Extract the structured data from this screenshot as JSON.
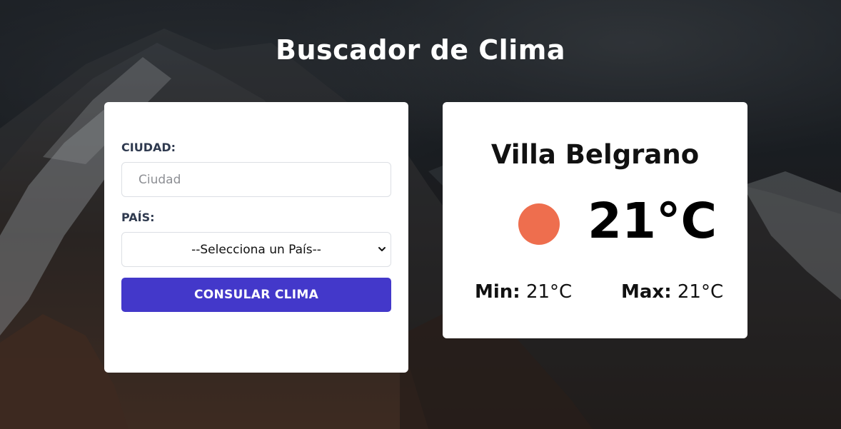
{
  "header": {
    "title": "Buscador de Clima"
  },
  "form": {
    "city_label": "CIUDAD:",
    "city_placeholder": "Ciudad",
    "city_value": "",
    "country_label": "PAÍS:",
    "country_selected": "--Selecciona un País--",
    "submit_label": "CONSULAR CLIMA",
    "submit_color": "#4338ca"
  },
  "result": {
    "city": "Villa Belgrano",
    "temperature": "21°C",
    "min_label": "Min:",
    "min_value": "21°C",
    "max_label": "Max:",
    "max_value": "21°C",
    "indicator_color": "#ee6e4e",
    "indicator_icon": "sun-dot-icon"
  }
}
